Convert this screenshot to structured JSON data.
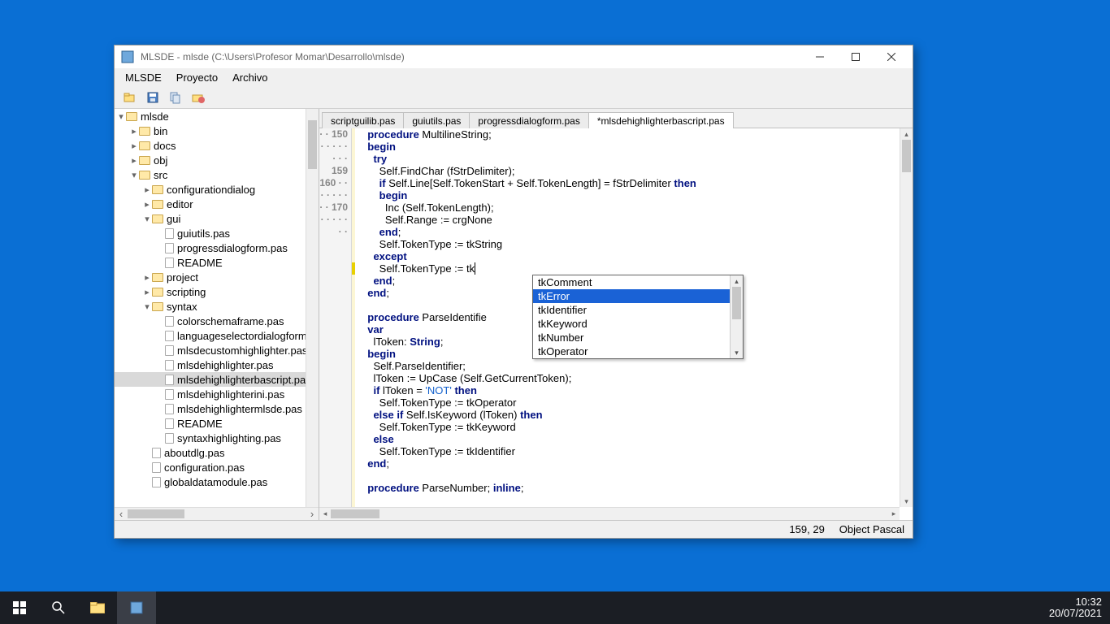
{
  "window": {
    "title": "MLSDE - mlsde (C:\\Users\\Profesor Momar\\Desarrollo\\mlsde)"
  },
  "menu": {
    "items": [
      "MLSDE",
      "Proyecto",
      "Archivo"
    ]
  },
  "tree": {
    "root": "mlsde",
    "nodes": [
      {
        "t": "f",
        "d": 1,
        "exp": "-",
        "l": "mlsde"
      },
      {
        "t": "f",
        "d": 2,
        "exp": ">",
        "l": "bin"
      },
      {
        "t": "f",
        "d": 2,
        "exp": ">",
        "l": "docs"
      },
      {
        "t": "f",
        "d": 2,
        "exp": ">",
        "l": "obj"
      },
      {
        "t": "f",
        "d": 2,
        "exp": "-",
        "l": "src"
      },
      {
        "t": "f",
        "d": 3,
        "exp": ">",
        "l": "configurationdialog"
      },
      {
        "t": "f",
        "d": 3,
        "exp": ">",
        "l": "editor"
      },
      {
        "t": "f",
        "d": 3,
        "exp": "-",
        "l": "gui"
      },
      {
        "t": "p",
        "d": 4,
        "l": "guiutils.pas"
      },
      {
        "t": "p",
        "d": 4,
        "l": "progressdialogform.pas"
      },
      {
        "t": "p",
        "d": 4,
        "l": "README"
      },
      {
        "t": "f",
        "d": 3,
        "exp": ">",
        "l": "project"
      },
      {
        "t": "f",
        "d": 3,
        "exp": ">",
        "l": "scripting"
      },
      {
        "t": "f",
        "d": 3,
        "exp": "-",
        "l": "syntax"
      },
      {
        "t": "p",
        "d": 4,
        "l": "colorschemaframe.pas"
      },
      {
        "t": "p",
        "d": 4,
        "l": "languageselectordialogform.p"
      },
      {
        "t": "p",
        "d": 4,
        "l": "mlsdecustomhighlighter.pas"
      },
      {
        "t": "p",
        "d": 4,
        "l": "mlsdehighlighter.pas"
      },
      {
        "t": "p",
        "d": 4,
        "l": "mlsdehighlighterbascript.pas",
        "sel": true
      },
      {
        "t": "p",
        "d": 4,
        "l": "mlsdehighlighterini.pas"
      },
      {
        "t": "p",
        "d": 4,
        "l": "mlsdehighlightermlsde.pas"
      },
      {
        "t": "p",
        "d": 4,
        "l": "README"
      },
      {
        "t": "p",
        "d": 4,
        "l": "syntaxhighlighting.pas"
      },
      {
        "t": "p",
        "d": 3,
        "l": "aboutdlg.pas"
      },
      {
        "t": "p",
        "d": 3,
        "l": "configuration.pas"
      },
      {
        "t": "p",
        "d": 3,
        "l": "globaldatamodule.pas"
      }
    ]
  },
  "tabs": [
    {
      "label": "scriptguilib.pas",
      "active": false
    },
    {
      "label": "guiutils.pas",
      "active": false
    },
    {
      "label": "progressdialogform.pas",
      "active": false
    },
    {
      "label": "*mlsdehighlighterbascript.pas",
      "active": true
    }
  ],
  "editor": {
    "gutter_150": "150",
    "gutter_159": "159",
    "gutter_160": "160",
    "gutter_170": "170",
    "cursor_line": 159
  },
  "autocomplete": {
    "items": [
      "tkComment",
      "tkError",
      "tkIdentifier",
      "tkKeyword",
      "tkNumber",
      "tkOperator"
    ],
    "selected": 1
  },
  "status": {
    "pos": "159, 29",
    "lang": "Object Pascal"
  },
  "systray": {
    "time": "10:32",
    "date": "20/07/2021"
  }
}
